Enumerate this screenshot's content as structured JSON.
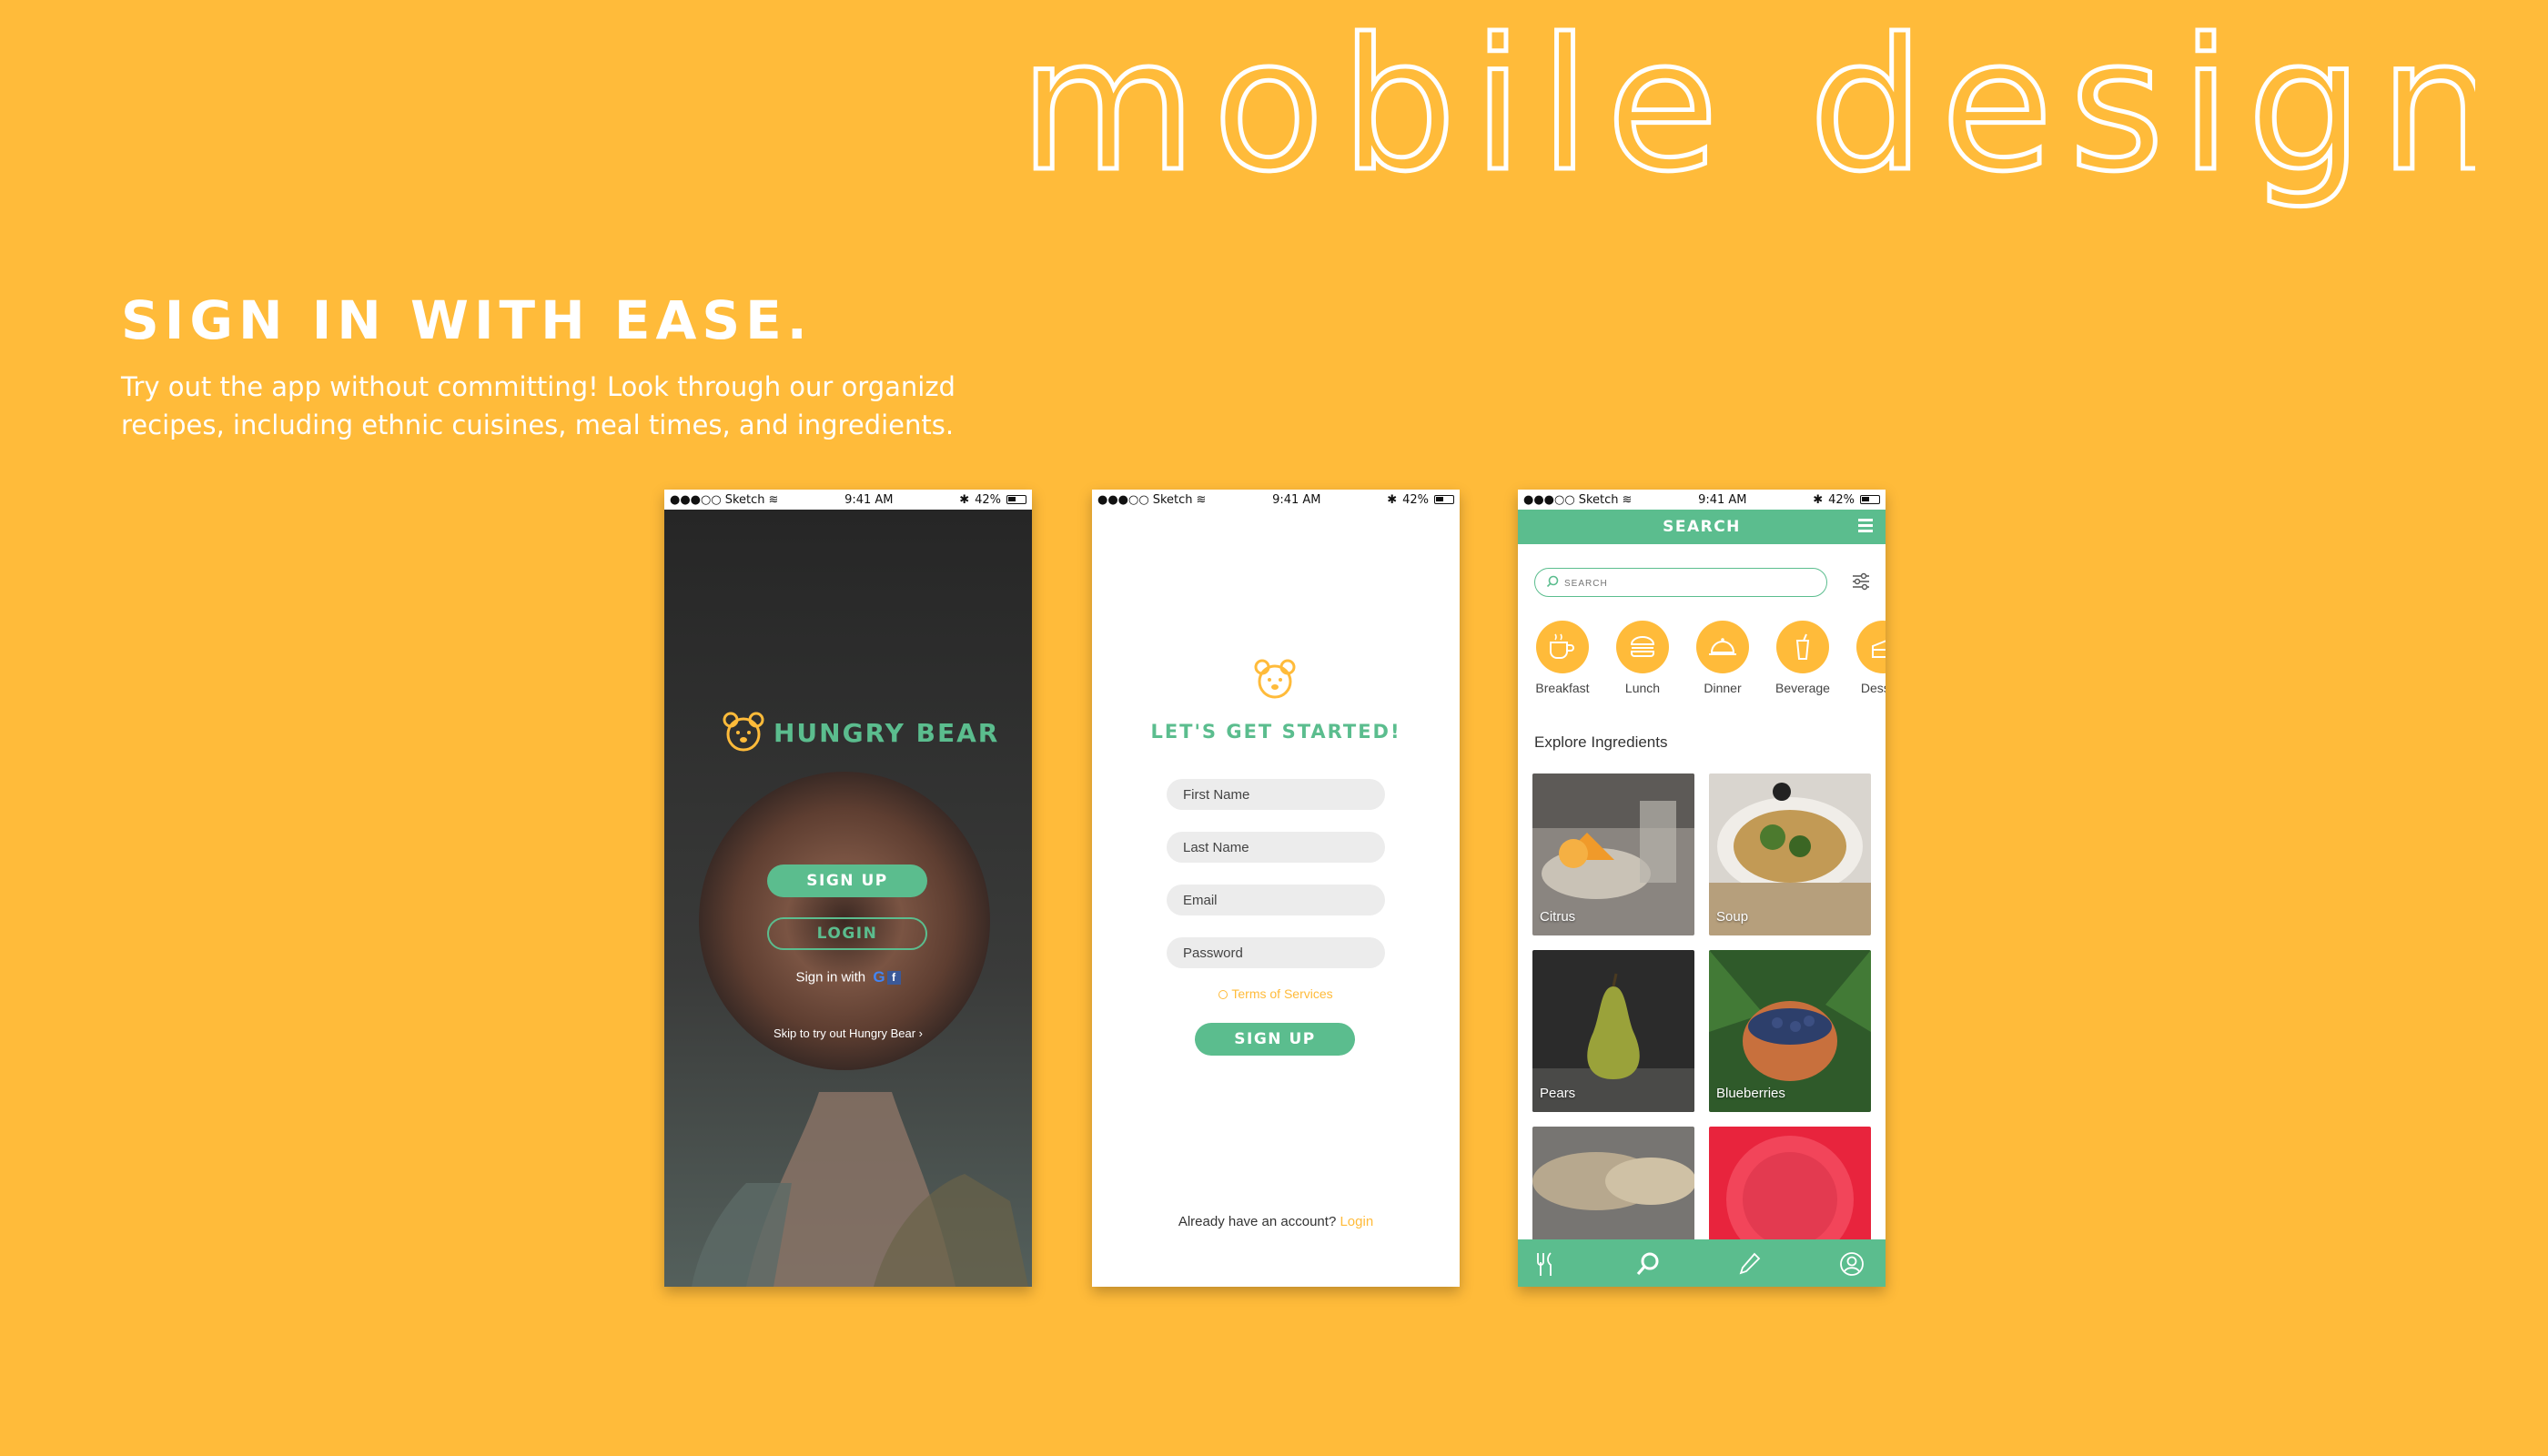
{
  "hero": {
    "title": "mobile design"
  },
  "headline": "SIGN IN WITH EASE.",
  "subcopy": "Try out the app without committing! Look through our organizd recipes, including ethnic cuisines, meal times, and ingredients.",
  "colors": {
    "background": "#FFBB3A",
    "accent": "#5bbd8e",
    "link": "#FFBB3A"
  },
  "status_bar": {
    "carrier": "Sketch",
    "time": "9:41 AM",
    "battery": "42%"
  },
  "screen_signin": {
    "brand": "HUNGRY BEAR",
    "signup_label": "SIGN UP",
    "login_label": "LOGIN",
    "social_label": "Sign in with",
    "skip_label": "Skip to try out Hungry Bear",
    "skip_icon": "chevron-right-icon"
  },
  "screen_register": {
    "title": "LET'S GET STARTED!",
    "first_name_placeholder": "First Name",
    "last_name_placeholder": "Last Name",
    "email_placeholder": "Email",
    "password_placeholder": "Password",
    "terms_label": "Terms of Services",
    "signup_label": "SIGN UP",
    "already_text": "Already have an account?",
    "login_link": "Login"
  },
  "screen_search": {
    "title": "SEARCH",
    "search_placeholder": "SEARCH",
    "categories": [
      {
        "label": "Breakfast",
        "icon": "coffee-cup-icon"
      },
      {
        "label": "Lunch",
        "icon": "burger-icon"
      },
      {
        "label": "Dinner",
        "icon": "cloche-icon"
      },
      {
        "label": "Beverage",
        "icon": "drink-icon"
      },
      {
        "label": "Dessert",
        "icon": "cake-icon"
      }
    ],
    "section_title": "Explore Ingredients",
    "ingredients": [
      {
        "label": "Citrus"
      },
      {
        "label": "Soup"
      },
      {
        "label": "Pears"
      },
      {
        "label": "Blueberries"
      },
      {
        "label": ""
      },
      {
        "label": ""
      }
    ],
    "tabs": [
      "utensils-icon",
      "search-icon",
      "pencil-icon",
      "profile-icon"
    ]
  }
}
